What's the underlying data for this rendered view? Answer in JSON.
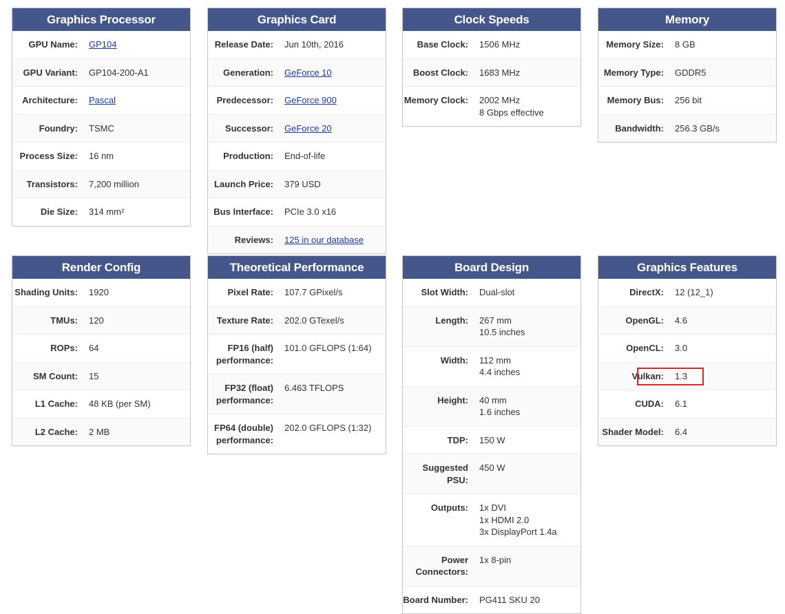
{
  "cards": {
    "gpu": {
      "title": "Graphics Processor",
      "rows": [
        {
          "label": "GPU Name:",
          "value": "GP104"
        },
        {
          "label": "GPU Variant:",
          "value": "GP104-200-A1"
        },
        {
          "label": "Architecture:",
          "value": "Pascal"
        },
        {
          "label": "Foundry:",
          "value": "TSMC"
        },
        {
          "label": "Process Size:",
          "value": "16 nm"
        },
        {
          "label": "Transistors:",
          "value": "7,200 million"
        },
        {
          "label": "Die Size:",
          "value": "314 mm²"
        }
      ]
    },
    "card": {
      "title": "Graphics Card",
      "rows": [
        {
          "label": "Release Date:",
          "value": "Jun 10th, 2016"
        },
        {
          "label": "Generation:",
          "value": "GeForce 10"
        },
        {
          "label": "Predecessor:",
          "value": "GeForce 900"
        },
        {
          "label": "Successor:",
          "value": "GeForce 20"
        },
        {
          "label": "Production:",
          "value": "End-of-life"
        },
        {
          "label": "Launch Price:",
          "value": "379 USD"
        },
        {
          "label": "Bus Interface:",
          "value": "PCIe 3.0 x16"
        },
        {
          "label": "Reviews:",
          "value": "125 in our database"
        }
      ]
    },
    "clock": {
      "title": "Clock Speeds",
      "rows": [
        {
          "label": "Base Clock:",
          "value": "1506 MHz"
        },
        {
          "label": "Boost Clock:",
          "value": "1683 MHz"
        },
        {
          "label": "Memory Clock:",
          "value": "2002 MHz",
          "value2": "8 Gbps effective"
        }
      ]
    },
    "memory": {
      "title": "Memory",
      "rows": [
        {
          "label": "Memory Size:",
          "value": "8 GB"
        },
        {
          "label": "Memory Type:",
          "value": "GDDR5"
        },
        {
          "label": "Memory Bus:",
          "value": "256 bit"
        },
        {
          "label": "Bandwidth:",
          "value": "256.3 GB/s"
        }
      ]
    },
    "render": {
      "title": "Render Config",
      "rows": [
        {
          "label": "Shading Units:",
          "value": "1920"
        },
        {
          "label": "TMUs:",
          "value": "120"
        },
        {
          "label": "ROPs:",
          "value": "64"
        },
        {
          "label": "SM Count:",
          "value": "15"
        },
        {
          "label": "L1 Cache:",
          "value": "48 KB (per SM)"
        },
        {
          "label": "L2 Cache:",
          "value": "2 MB"
        }
      ]
    },
    "perf": {
      "title": "Theoretical Performance",
      "rows": [
        {
          "label": "Pixel Rate:",
          "value": "107.7 GPixel/s"
        },
        {
          "label": "Texture Rate:",
          "value": "202.0 GTexel/s"
        },
        {
          "label1": "FP16 (half)",
          "label2": "performance:",
          "value": "101.0 GFLOPS (1:64)"
        },
        {
          "label1": "FP32 (float)",
          "label2": "performance:",
          "value": "6.463 TFLOPS"
        },
        {
          "label1": "FP64 (double)",
          "label2": "performance:",
          "value": "202.0 GFLOPS (1:32)"
        }
      ]
    },
    "board": {
      "title": "Board Design",
      "rows": [
        {
          "label": "Slot Width:",
          "value": "Dual-slot"
        },
        {
          "label": "Length:",
          "value": "267 mm",
          "value2": "10.5 inches"
        },
        {
          "label": "Width:",
          "value": "112 mm",
          "value2": "4.4 inches"
        },
        {
          "label": "Height:",
          "value": "40 mm",
          "value2": "1.6 inches"
        },
        {
          "label": "TDP:",
          "value": "150 W"
        },
        {
          "label": "Suggested PSU:",
          "value": "450 W"
        },
        {
          "label": "Outputs:",
          "value": "1x DVI",
          "value2": "1x HDMI 2.0",
          "value3": "3x DisplayPort 1.4a"
        },
        {
          "label1": "Power",
          "label2": "Connectors:",
          "value": "1x 8-pin"
        },
        {
          "label": "Board Number:",
          "value": "PG411 SKU 20"
        }
      ]
    },
    "features": {
      "title": "Graphics Features",
      "rows": [
        {
          "label": "DirectX:",
          "value": "12 (12_1)"
        },
        {
          "label": "OpenGL:",
          "value": "4.6"
        },
        {
          "label": "OpenCL:",
          "value": "3.0"
        },
        {
          "label": "Vulkan:",
          "value": "1.3"
        },
        {
          "label": "CUDA:",
          "value": "6.1"
        },
        {
          "label": "Shader Model:",
          "value": "6.4"
        }
      ]
    }
  },
  "colors": {
    "header_bg": "#45578a",
    "link": "#1c3a9c",
    "highlight": "#d8262b"
  }
}
